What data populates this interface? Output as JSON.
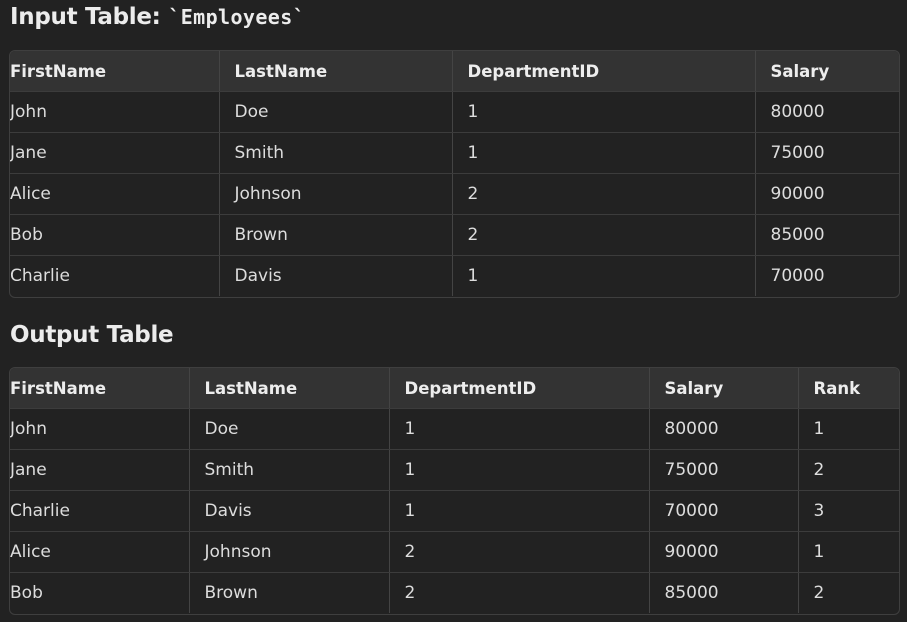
{
  "input_section": {
    "heading": "Input Table: ",
    "heading_code": "`Employees`",
    "columns": [
      "FirstName",
      "LastName",
      "DepartmentID",
      "Salary"
    ],
    "rows": [
      [
        "John",
        "Doe",
        "1",
        "80000"
      ],
      [
        "Jane",
        "Smith",
        "1",
        "75000"
      ],
      [
        "Alice",
        "Johnson",
        "2",
        "90000"
      ],
      [
        "Bob",
        "Brown",
        "2",
        "85000"
      ],
      [
        "Charlie",
        "Davis",
        "1",
        "70000"
      ]
    ]
  },
  "output_section": {
    "heading": "Output Table",
    "columns": [
      "FirstName",
      "LastName",
      "DepartmentID",
      "Salary",
      "Rank"
    ],
    "rows": [
      [
        "John",
        "Doe",
        "1",
        "80000",
        "1"
      ],
      [
        "Jane",
        "Smith",
        "1",
        "75000",
        "2"
      ],
      [
        "Charlie",
        "Davis",
        "1",
        "70000",
        "3"
      ],
      [
        "Alice",
        "Johnson",
        "2",
        "90000",
        "1"
      ],
      [
        "Bob",
        "Brown",
        "2",
        "85000",
        "2"
      ]
    ]
  },
  "colors": {
    "background": "#222222",
    "header_background": "#333333",
    "border": "#444444",
    "text": "#e6e6e6"
  }
}
